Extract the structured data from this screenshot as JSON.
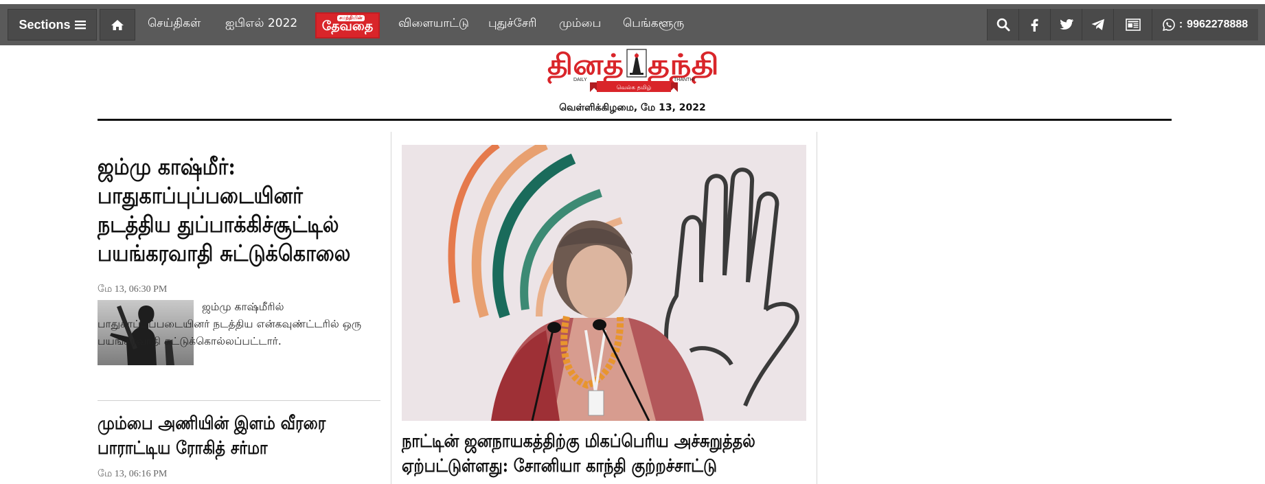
{
  "nav": {
    "sections_label": "Sections",
    "links": [
      "செய்திகள்",
      "ஐபிஎல் 2022",
      "விளையாட்டு",
      "புதுச்சேரி",
      "மும்பை",
      "பெங்களூரு"
    ],
    "devathai_label": "தேவதை",
    "devathai_tag": "சமந்தியின்",
    "phone": "9962278888",
    "icons": [
      "home-icon",
      "search-icon",
      "facebook-icon",
      "twitter-icon",
      "telegram-icon",
      "epaper-icon",
      "whatsapp-icon"
    ]
  },
  "masthead": {
    "logo_text": "தினத்தந்தி",
    "logo_sub_left": "DAILY",
    "logo_sub_right": "THANTHI",
    "logo_ribbon": "வெல்க தமிழ்",
    "date": "வெள்ளிக்கிழமை, மே 13, 2022"
  },
  "colors": {
    "nav_bg": "#5a5a5a",
    "nav_btn": "#4a4a4a",
    "brand_red": "#d9252a"
  },
  "stories": [
    {
      "headline": "ஜம்மு காஷ்மீர்: பாதுகாப்புப்படையினர் நடத்திய துப்பாக்கிச்சூட்டில் பயங்கரவாதி சுட்டுக்கொலை",
      "time": "மே 13, 06:30 PM",
      "summary": "ஜம்மு காஷ்மீரில் பாதுகாப்புப்படையினர் நடத்திய என்கவுண்ட்டரில் ஒரு பயங்கரவாதி சுட்டுக்கொல்லப்பட்டார்."
    },
    {
      "headline": "மும்பை அணியின் இளம் வீரரை பாராட்டிய ரோகித் சர்மா",
      "time": "மே 13, 06:16 PM"
    }
  ],
  "lead": {
    "headline": "நாட்டின் ஜனநாயகத்திற்கு மிகப்பெரிய அச்சுறுத்தல் ஏற்பட்டுள்ளது: சோனியா காந்தி குற்றச்சாட்டு"
  }
}
